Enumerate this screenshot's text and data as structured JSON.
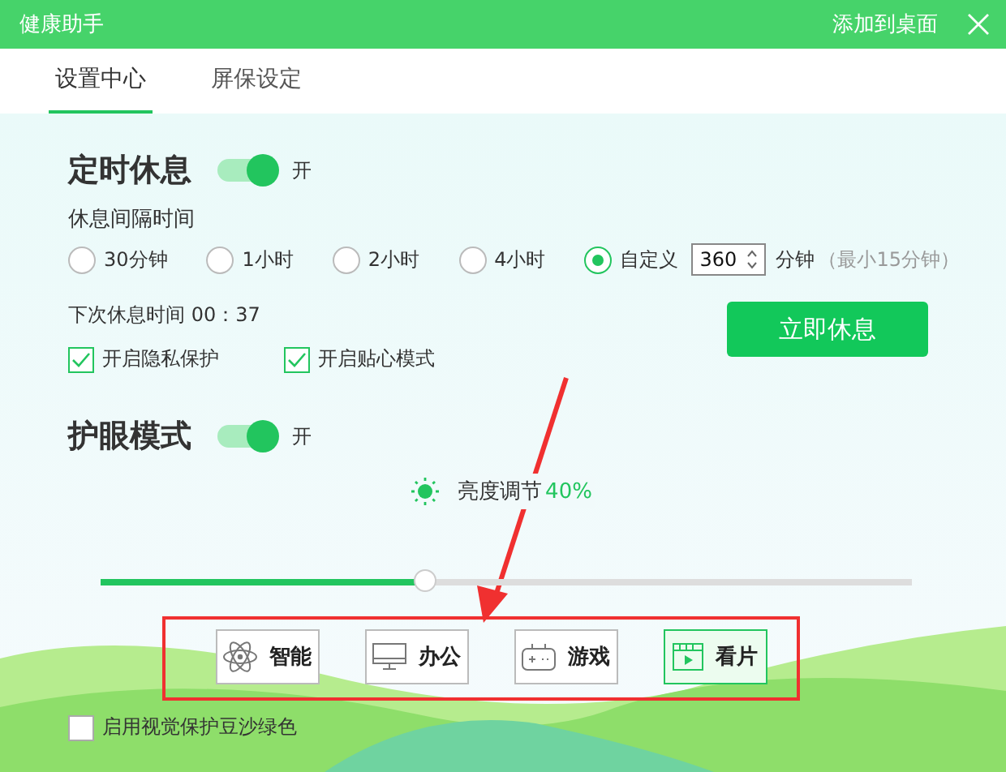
{
  "window": {
    "title": "健康助手",
    "add_to_desktop": "添加到桌面"
  },
  "tabs": [
    {
      "label": "设置中心",
      "selected": true
    },
    {
      "label": "屏保设定",
      "selected": false
    }
  ],
  "rest": {
    "title": "定时休息",
    "enabled": true,
    "state_label": "开",
    "interval_label": "休息间隔时间",
    "options": [
      {
        "label": "30分钟",
        "selected": false
      },
      {
        "label": "1小时",
        "selected": false
      },
      {
        "label": "2小时",
        "selected": false
      },
      {
        "label": "4小时",
        "selected": false
      },
      {
        "label": "自定义",
        "selected": true
      }
    ],
    "custom_value": "360",
    "unit": "分钟",
    "hint": "（最小15分钟）",
    "next_rest": "下次休息时间 00：37",
    "checkboxes": [
      {
        "label": "开启隐私保护",
        "checked": true
      },
      {
        "label": "开启贴心模式",
        "checked": true
      }
    ],
    "button": "立即休息"
  },
  "eye": {
    "title": "护眼模式",
    "enabled": true,
    "state_label": "开",
    "brightness_label": "亮度调节",
    "brightness_value": "40%",
    "level": 0.4,
    "modes": [
      {
        "kind": "smart",
        "label": "智能",
        "selected": false
      },
      {
        "kind": "office",
        "label": "办公",
        "selected": false
      },
      {
        "kind": "game",
        "label": "游戏",
        "selected": false
      },
      {
        "kind": "movie",
        "label": "看片",
        "selected": true
      }
    ],
    "green_bg": {
      "label": "启用视觉保护豆沙绿色",
      "checked": false
    }
  }
}
